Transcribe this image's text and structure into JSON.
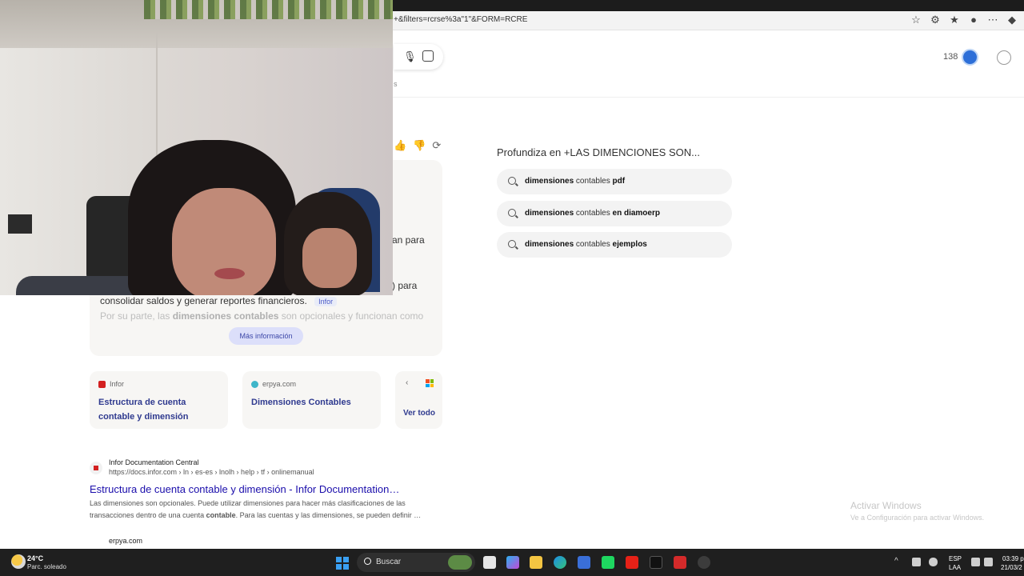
{
  "browser": {
    "url_fragment": "+&filters=rcrse%3a\"1\"&FORM=RCRE"
  },
  "header": {
    "rewards_points": "138",
    "tabs_tail": "s"
  },
  "answer": {
    "fragment_1": "an para",
    "fragment_2": ") para",
    "line_1": "consolidar saldos y generar reportes financieros.",
    "citation": "Infor",
    "line_2_pre": "Por su parte, las ",
    "line_2_bold": "dimensiones contables",
    "line_2_post": " son opcionales y funcionan como",
    "more_button": "Más información"
  },
  "sources": [
    {
      "site": "Infor",
      "title": "Estructura de cuenta contable y dimensión",
      "favicon_color": "#d32020"
    },
    {
      "site": "erpya.com",
      "title": "Dimensiones Contables",
      "favicon_color": "#3fb6c9"
    }
  ],
  "sources_nav": {
    "prev": "‹",
    "see_all": "Ver todo"
  },
  "result": {
    "site_name": "Infor Documentation Central",
    "url": "https://docs.infor.com › ln › es-es › lnolh › help › tf › onlinemanual",
    "title": "Estructura de cuenta contable y dimensión - Infor Documentation…",
    "snippet_1": "Las dimensiones son opcionales. Puede utilizar dimensiones para hacer más clasificaciones de las",
    "snippet_2_pre": "transacciones dentro de una cuenta ",
    "snippet_2_bold": "contable",
    "snippet_2_post": ". Para las cuentas y las dimensiones, se pueden definir …"
  },
  "next_result": {
    "site_name": "erpya.com"
  },
  "related": {
    "title": "Profundiza en +LAS DIMENCIONES SON...",
    "items": [
      {
        "bold": "dimensiones",
        "normal": " contables ",
        "suffix": "pdf"
      },
      {
        "bold": "dimensiones",
        "normal": " contables ",
        "suffix": "en diamoerp"
      },
      {
        "bold": "dimensiones",
        "normal": " contables ",
        "suffix": "ejemplos"
      }
    ]
  },
  "watermark": {
    "line_1": "Activar Windows",
    "line_2": "Ve a Configuración para activar Windows."
  },
  "taskbar": {
    "temperature": "24°C",
    "condition": "Parc. soleado",
    "search_label": "Buscar",
    "tray_chevron": "^",
    "lang_1": "ESP",
    "lang_2": "LAA",
    "time": "03:39 p",
    "date": "21/03/2"
  }
}
